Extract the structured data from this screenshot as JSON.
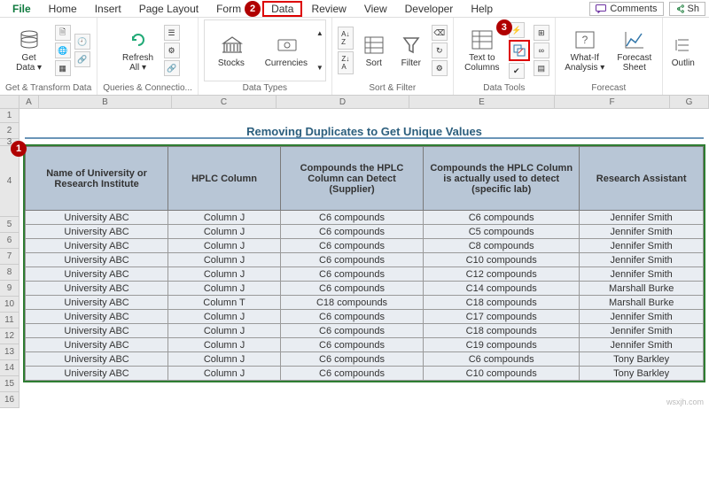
{
  "menu": {
    "tabs": [
      "File",
      "Home",
      "Insert",
      "Page Layout",
      "Formulas",
      "Data",
      "Review",
      "View",
      "Developer",
      "Help"
    ],
    "active": "Data",
    "comments": "Comments",
    "share_partial": "Sh"
  },
  "ribbon": {
    "group1": {
      "label": "Get & Transform Data",
      "get_data": "Get\nData ▾"
    },
    "group2": {
      "label": "Queries & Connectio...",
      "refresh": "Refresh\nAll ▾"
    },
    "group3": {
      "label": "Data Types",
      "stocks": "Stocks",
      "currencies": "Currencies"
    },
    "group4": {
      "label": "Sort & Filter",
      "sort": "Sort",
      "filter": "Filter"
    },
    "group5": {
      "label": "Data Tools",
      "t2c": "Text to\nColumns"
    },
    "group6": {
      "label": "Forecast",
      "whatif": "What-If\nAnalysis ▾",
      "forecast": "Forecast\nSheet"
    },
    "group7": {
      "outline": "Outlin"
    }
  },
  "badges": {
    "b1": "1",
    "b2": "2",
    "b3": "3"
  },
  "col_letters": [
    "A",
    "B",
    "C",
    "D",
    "E",
    "F",
    "G"
  ],
  "row_nums": [
    "1",
    "2",
    "3",
    "4",
    "5",
    "6",
    "7",
    "8",
    "9",
    "10",
    "11",
    "12",
    "13",
    "14",
    "15",
    "16"
  ],
  "title": "Removing Duplicates to Get Unique Values",
  "headers": [
    "Name of University or Research Institute",
    "HPLC Column",
    "Compounds the HPLC Column can Detect (Supplier)",
    "Compounds the HPLC Column is actually used to detect (specific lab)",
    "Research Assistant"
  ],
  "rows": [
    [
      "University ABC",
      "Column J",
      "C6 compounds",
      "C6 compounds",
      "Jennifer Smith"
    ],
    [
      "University ABC",
      "Column J",
      "C6 compounds",
      "C5 compounds",
      "Jennifer Smith"
    ],
    [
      "University ABC",
      "Column J",
      "C6 compounds",
      "C8 compounds",
      "Jennifer Smith"
    ],
    [
      "University ABC",
      "Column J",
      "C6 compounds",
      "C10 compounds",
      "Jennifer Smith"
    ],
    [
      "University ABC",
      "Column J",
      "C6 compounds",
      "C12 compounds",
      "Jennifer Smith"
    ],
    [
      "University ABC",
      "Column J",
      "C6 compounds",
      "C14 compounds",
      "Marshall Burke"
    ],
    [
      "University ABC",
      "Column T",
      "C18 compounds",
      "C18 compounds",
      "Marshall Burke"
    ],
    [
      "University ABC",
      "Column J",
      "C6 compounds",
      "C17 compounds",
      "Jennifer Smith"
    ],
    [
      "University ABC",
      "Column J",
      "C6 compounds",
      "C18 compounds",
      "Jennifer Smith"
    ],
    [
      "University ABC",
      "Column J",
      "C6 compounds",
      "C19 compounds",
      "Jennifer Smith"
    ],
    [
      "University ABC",
      "Column J",
      "C6 compounds",
      "C6 compounds",
      "Tony Barkley"
    ],
    [
      "University ABC",
      "Column J",
      "C6 compounds",
      "C10 compounds",
      "Tony Barkley"
    ]
  ],
  "watermark": "wsxjh.com"
}
